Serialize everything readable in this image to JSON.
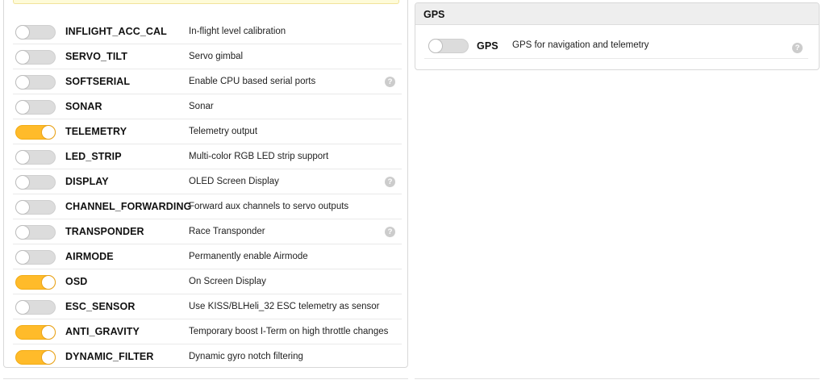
{
  "features": [
    {
      "id": "inflight_acc_cal",
      "name": "INFLIGHT_ACC_CAL",
      "description": "In-flight level calibration",
      "enabled": false,
      "help": false
    },
    {
      "id": "servo_tilt",
      "name": "SERVO_TILT",
      "description": "Servo gimbal",
      "enabled": false,
      "help": false
    },
    {
      "id": "softserial",
      "name": "SOFTSERIAL",
      "description": "Enable CPU based serial ports",
      "enabled": false,
      "help": true
    },
    {
      "id": "sonar",
      "name": "SONAR",
      "description": "Sonar",
      "enabled": false,
      "help": false
    },
    {
      "id": "telemetry",
      "name": "TELEMETRY",
      "description": "Telemetry output",
      "enabled": true,
      "help": false
    },
    {
      "id": "led_strip",
      "name": "LED_STRIP",
      "description": "Multi-color RGB LED strip support",
      "enabled": false,
      "help": false
    },
    {
      "id": "display",
      "name": "DISPLAY",
      "description": "OLED Screen Display",
      "enabled": false,
      "help": true
    },
    {
      "id": "channel_forwarding",
      "name": "CHANNEL_FORWARDING",
      "description": "Forward aux channels to servo outputs",
      "enabled": false,
      "help": false
    },
    {
      "id": "transponder",
      "name": "TRANSPONDER",
      "description": "Race Transponder",
      "enabled": false,
      "help": true
    },
    {
      "id": "airmode",
      "name": "AIRMODE",
      "description": "Permanently enable Airmode",
      "enabled": false,
      "help": false
    },
    {
      "id": "osd",
      "name": "OSD",
      "description": "On Screen Display",
      "enabled": true,
      "help": false
    },
    {
      "id": "esc_sensor",
      "name": "ESC_SENSOR",
      "description": "Use KISS/BLHeli_32 ESC telemetry as sensor",
      "enabled": false,
      "help": false
    },
    {
      "id": "anti_gravity",
      "name": "ANTI_GRAVITY",
      "description": "Temporary boost I-Term on high throttle changes",
      "enabled": true,
      "help": false
    },
    {
      "id": "dynamic_filter",
      "name": "DYNAMIC_FILTER",
      "description": "Dynamic gyro notch filtering",
      "enabled": true,
      "help": false
    }
  ],
  "gps_panel": {
    "title": "GPS",
    "feature": {
      "name": "GPS",
      "description": "GPS for navigation and telemetry",
      "enabled": false,
      "help": true
    }
  },
  "help_glyph": "?",
  "icons": {
    "help": "question-circle-icon"
  },
  "colors": {
    "toggle_on": "#ffbb2a",
    "toggle_off": "#dcdcdc",
    "help_icon": "#cccccc",
    "warning_bg": "#fefbd8",
    "panel_header_bg": "#eeeeee"
  }
}
